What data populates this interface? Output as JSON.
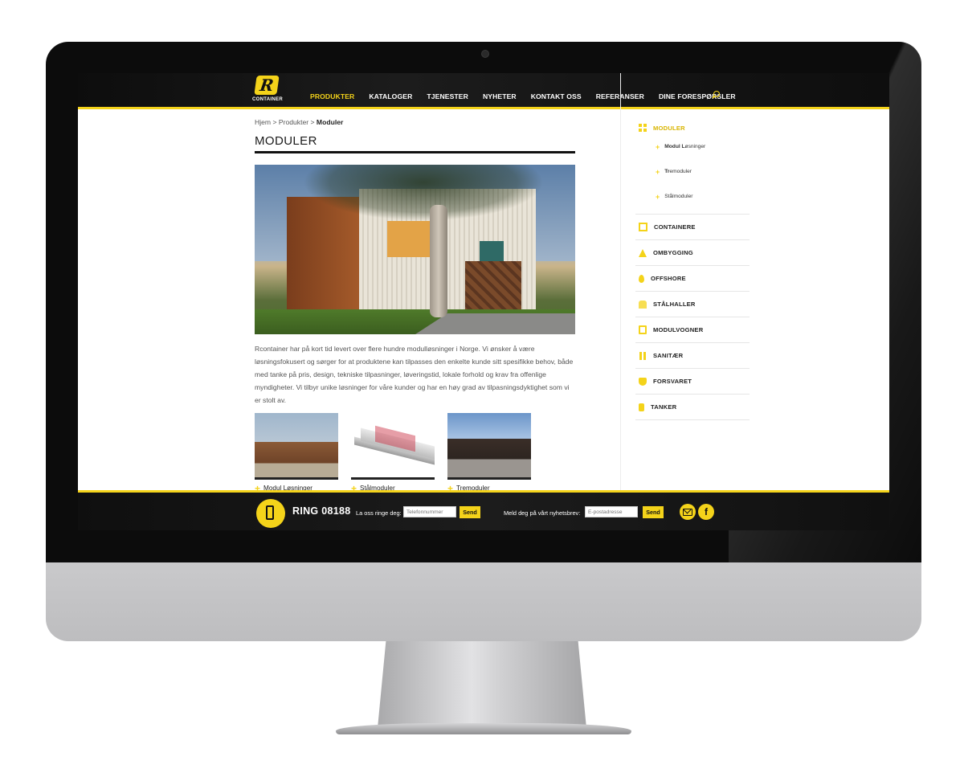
{
  "brand": {
    "logo_letter": "R",
    "logo_text": "CONTAINER"
  },
  "nav": {
    "items": [
      {
        "label": "PRODUKTER",
        "active": true
      },
      {
        "label": "KATALOGER"
      },
      {
        "label": "TJENESTER"
      },
      {
        "label": "NYHETER"
      },
      {
        "label": "KONTAKT OSS"
      },
      {
        "label": "REFERANSER"
      },
      {
        "label": "DINE FORESPØRSLER"
      }
    ]
  },
  "breadcrumb": {
    "home": "Hjem",
    "sep": " > ",
    "level2": "Produkter",
    "current": "Moduler"
  },
  "page_title": "MODULER",
  "intro": "Rcontainer har på kort tid levert over flere hundre modulløsninger i Norge. Vi ønsker å være løsningsfokusert og sørger for at produktene kan tilpasses den enkelte kunde sitt spesifikke behov, både med tanke på pris, design, tekniske tilpasninger, løveringstid, lokale forhold og krav fra offenlige myndigheter. Vi tilbyr unike løsninger for våre kunder og har en høy grad av tilpasningsdyktighet som vi er stolt av.",
  "products": [
    {
      "label": "Modul Løsninger"
    },
    {
      "label": "Stålmoduler"
    },
    {
      "label": "Tremoduler"
    }
  ],
  "sidebar": {
    "active": {
      "label": "MODULER",
      "icon": "grid-icon"
    },
    "subitems": [
      {
        "prefix": "Modul L",
        "rest": "øsninger"
      },
      {
        "prefix": "Tr",
        "rest": "emoduler"
      },
      {
        "prefix": "",
        "rest": "Stålmoduler"
      }
    ],
    "items": [
      {
        "label": "CONTAINERE",
        "icon": "container-icon"
      },
      {
        "label": "OMBYGGING",
        "icon": "cone-icon"
      },
      {
        "label": "OFFSHORE",
        "icon": "drop-icon"
      },
      {
        "label": "STÅLHALLER",
        "icon": "hall-icon"
      },
      {
        "label": "MODULVOGNER",
        "icon": "wagon-icon"
      },
      {
        "label": "SANITÆR",
        "icon": "sanitary-icon"
      },
      {
        "label": "FORSVARET",
        "icon": "shield-icon"
      },
      {
        "label": "TANKER",
        "icon": "tank-icon"
      }
    ]
  },
  "footer": {
    "phone_text": "RING 08188",
    "call_label": "La oss ringe deg:",
    "call_placeholder": "Telefonnummer",
    "call_button": "Send",
    "news_label": "Meld deg på vårt nyhetsbrev:",
    "news_placeholder": "E-postadresse",
    "news_button": "Send",
    "facebook": "f"
  },
  "colors": {
    "accent": "#f4d31a",
    "dark": "#111111"
  }
}
